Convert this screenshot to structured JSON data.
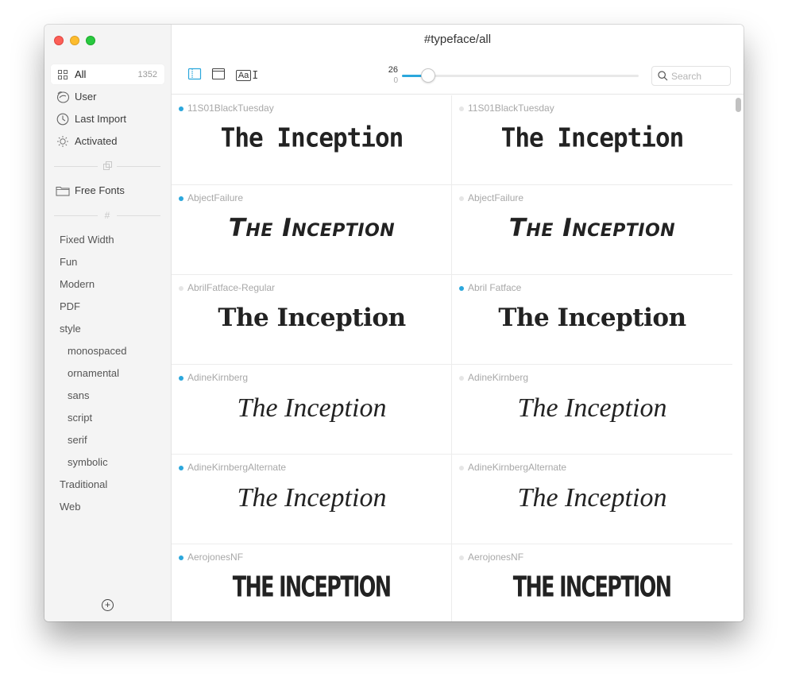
{
  "window": {
    "title": "#typeface/all"
  },
  "sidebar": {
    "nav": [
      {
        "label": "All",
        "icon": "grid-icon",
        "count": "1352",
        "selected": true
      },
      {
        "label": "User",
        "icon": "user-icon"
      },
      {
        "label": "Last Import",
        "icon": "clock-icon"
      },
      {
        "label": "Activated",
        "icon": "sun-icon"
      }
    ],
    "collections": [
      {
        "label": "Free Fonts",
        "icon": "folder-icon"
      }
    ],
    "tags": [
      {
        "label": "Fixed Width",
        "level": 0
      },
      {
        "label": "Fun",
        "level": 0
      },
      {
        "label": "Modern",
        "level": 0
      },
      {
        "label": "PDF",
        "level": 0
      },
      {
        "label": "style",
        "level": 0
      },
      {
        "label": "monospaced",
        "level": 1
      },
      {
        "label": "ornamental",
        "level": 1
      },
      {
        "label": "sans",
        "level": 1
      },
      {
        "label": "script",
        "level": 1
      },
      {
        "label": "serif",
        "level": 1
      },
      {
        "label": "symbolic",
        "level": 1
      },
      {
        "label": "Traditional",
        "level": 0
      },
      {
        "label": "Web",
        "level": 0
      }
    ],
    "add_button": "+"
  },
  "toolbar": {
    "size_slider": {
      "value": "26",
      "min": "0",
      "fraction": 0.11
    },
    "search": {
      "placeholder": "Search",
      "value": ""
    },
    "preview_text_button": "Aa"
  },
  "colors": {
    "accent": "#2ba7dc",
    "inactive_dot": "#e6e6e6"
  },
  "fonts": [
    [
      {
        "name": "11S01BlackTuesday",
        "active": true,
        "preview": "The Inception",
        "style": "tech"
      },
      {
        "name": "11S01BlackTuesday",
        "active": false,
        "preview": "The Inception",
        "style": "tech"
      }
    ],
    [
      {
        "name": "AbjectFailure",
        "active": true,
        "preview": "The Inception",
        "style": "hand"
      },
      {
        "name": "AbjectFailure",
        "active": false,
        "preview": "The Inception",
        "style": "hand"
      }
    ],
    [
      {
        "name": "AbrilFatface-Regular",
        "active": false,
        "preview": "The Inception",
        "style": "fat"
      },
      {
        "name": "Abril Fatface",
        "active": true,
        "preview": "The Inception",
        "style": "fat"
      }
    ],
    [
      {
        "name": "AdineKirnberg",
        "active": true,
        "preview": "The Inception",
        "style": "script"
      },
      {
        "name": "AdineKirnberg",
        "active": false,
        "preview": "The Inception",
        "style": "script"
      }
    ],
    [
      {
        "name": "AdineKirnbergAlternate",
        "active": true,
        "preview": "The Inception",
        "style": "script"
      },
      {
        "name": "AdineKirnbergAlternate",
        "active": false,
        "preview": "The Inception",
        "style": "script"
      }
    ],
    [
      {
        "name": "AerojonesNF",
        "active": true,
        "preview": "The Inception",
        "style": "block"
      },
      {
        "name": "AerojonesNF",
        "active": false,
        "preview": "The Inception",
        "style": "block"
      }
    ]
  ]
}
